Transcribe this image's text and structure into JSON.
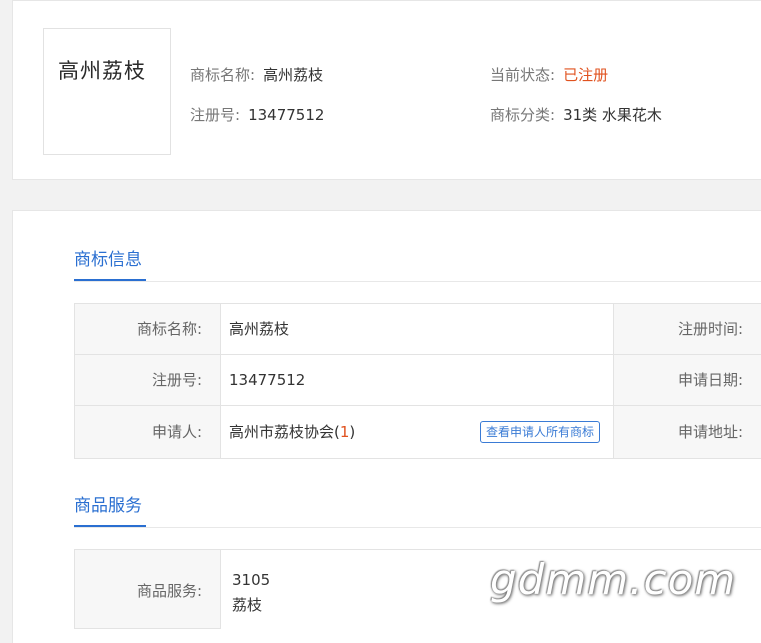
{
  "header": {
    "logo_text": "高州荔枝",
    "name_label": "商标名称:",
    "name_value": "高州荔枝",
    "reg_no_label": "注册号:",
    "reg_no_value": "13477512",
    "status_label": "当前状态:",
    "status_value": "已注册",
    "class_label": "商标分类:",
    "class_value": "31类 水果花木"
  },
  "trademark_info": {
    "section_title": "商标信息",
    "rows": [
      {
        "label": "商标名称:",
        "value": "高州荔枝",
        "label2": "注册时间:"
      },
      {
        "label": "注册号:",
        "value": "13477512",
        "label2": "申请日期:"
      },
      {
        "label": "申请人:",
        "value": "高州市荔枝协会",
        "count_open": "(",
        "count": "1",
        "count_close": ")",
        "button": "查看申请人所有商标",
        "label2": "申请地址:"
      }
    ]
  },
  "goods_services": {
    "section_title": "商品服务",
    "label": "商品服务:",
    "code": "3105",
    "item": "荔枝"
  },
  "watermark": "gdmm.com",
  "colors": {
    "accent_blue": "#2a6fd1",
    "status_red": "#e0521f",
    "label_bg": "#f7f7f7",
    "page_bg": "#f2f2f2"
  }
}
